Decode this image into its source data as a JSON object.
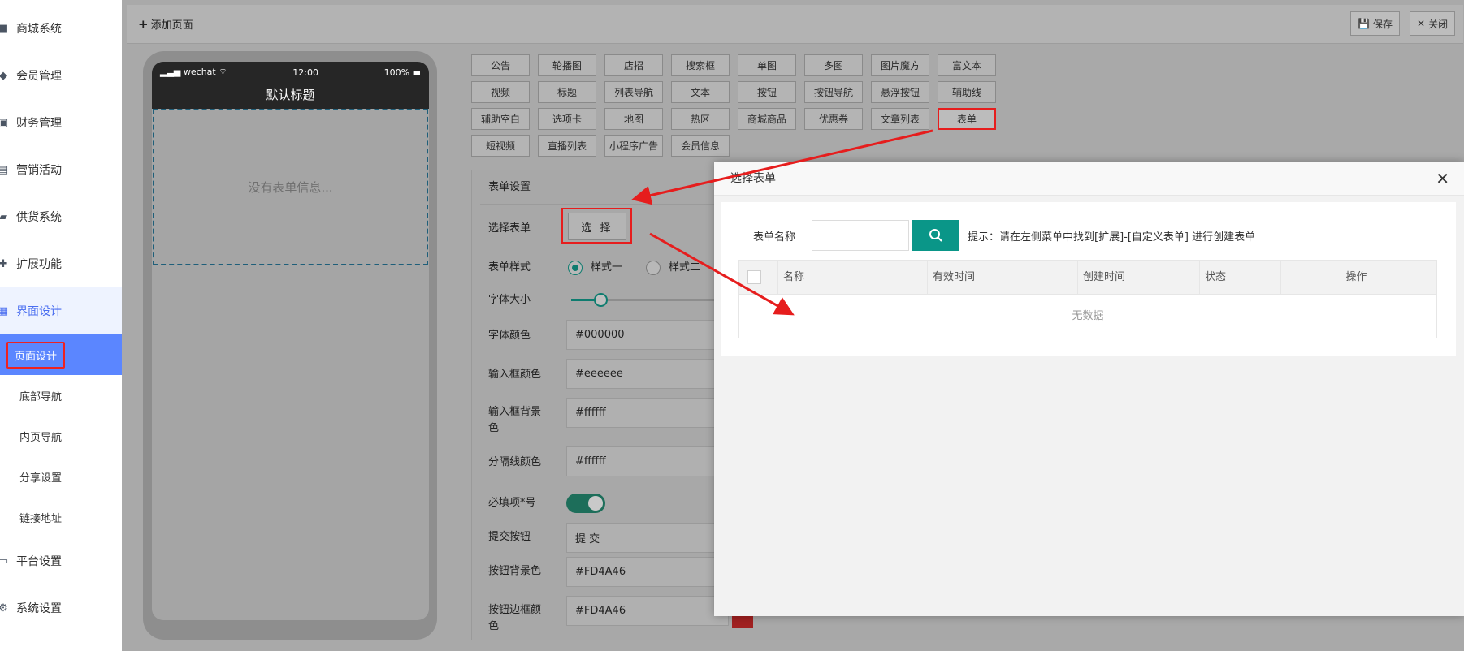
{
  "sidebar": {
    "items": [
      {
        "label": "商城系统",
        "icon": "bag-icon"
      },
      {
        "label": "会员管理",
        "icon": "diamond-icon"
      },
      {
        "label": "财务管理",
        "icon": "wallet-icon"
      },
      {
        "label": "营销活动",
        "icon": "gift-icon"
      },
      {
        "label": "供货系统",
        "icon": "truck-icon"
      },
      {
        "label": "扩展功能",
        "icon": "puzzle-icon"
      },
      {
        "label": "界面设计",
        "icon": "grid-icon"
      }
    ],
    "sub_items": [
      "页面设计",
      "底部导航",
      "内页导航",
      "分享设置",
      "链接地址"
    ],
    "bottom_items": [
      {
        "label": "平台设置",
        "icon": "monitor-icon"
      },
      {
        "label": "系统设置",
        "icon": "gear-icon"
      }
    ]
  },
  "toolbar": {
    "add_page": "添加页面",
    "save": "保存",
    "close": "关闭"
  },
  "phone": {
    "carrier": "wechat",
    "time": "12:00",
    "battery": "100%",
    "title": "默认标题",
    "empty_text": "没有表单信息..."
  },
  "components": [
    [
      "公告",
      "轮播图",
      "店招",
      "搜索框",
      "单图",
      "多图",
      "图片魔方",
      "富文本"
    ],
    [
      "视频",
      "标题",
      "列表导航",
      "文本",
      "按钮",
      "按钮导航",
      "悬浮按钮",
      "辅助线"
    ],
    [
      "辅助空白",
      "选项卡",
      "地图",
      "热区",
      "商城商品",
      "优惠券",
      "文章列表",
      "表单"
    ],
    [
      "短视频",
      "直播列表",
      "小程序广告",
      "会员信息"
    ]
  ],
  "settings": {
    "title": "表单设置",
    "select_form_label": "选择表单",
    "select_btn": "选 择",
    "style_label": "表单样式",
    "style_opt1": "样式一",
    "style_opt2": "样式二",
    "font_size_label": "字体大小",
    "font_color_label": "字体颜色",
    "font_color": "#000000",
    "input_color_label": "输入框颜色",
    "input_color": "#eeeeee",
    "input_bg_label": "输入框背景色",
    "input_bg": "#ffffff",
    "divider_label": "分隔线颜色",
    "divider": "#ffffff",
    "required_label": "必填项*号",
    "submit_label": "提交按钮",
    "submit_value": "提 交",
    "btn_bg_label": "按钮背景色",
    "btn_bg": "#FD4A46",
    "btn_border_label": "按钮边框颜色",
    "btn_border": "#FD4A46"
  },
  "modal": {
    "title": "选择表单",
    "form_name_label": "表单名称",
    "tip": "提示：请在左侧菜单中找到[扩展]-[自定义表单] 进行创建表单",
    "columns": [
      "名称",
      "有效时间",
      "创建时间",
      "状态",
      "操作"
    ],
    "empty": "无数据"
  },
  "colors": {
    "accent": "#5b86ff",
    "teal": "#0a9688",
    "highlight": "#e61d1d"
  }
}
